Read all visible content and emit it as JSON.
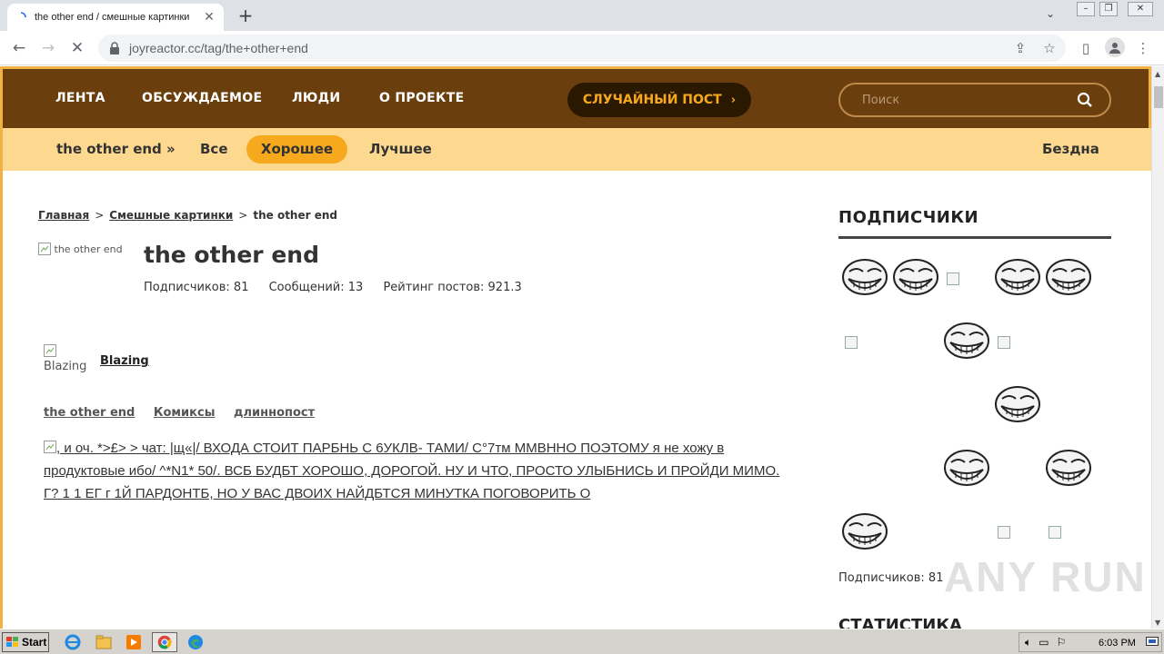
{
  "browser": {
    "tab_title": "the other end / смешные картинки",
    "url": "joyreactor.cc/tag/the+other+end"
  },
  "nav": {
    "links": [
      "ЛЕНТА",
      "ОБСУЖДАЕМОЕ",
      "ЛЮДИ",
      "О ПРОЕКТЕ"
    ],
    "random_post": "СЛУЧАЙНЫЙ ПОСТ",
    "search_placeholder": "Поиск"
  },
  "subnav": {
    "tag": "the other end »",
    "all": "Все",
    "good": "Хорошее",
    "best": "Лучшее",
    "abyss": "Бездна"
  },
  "breadcrumb": {
    "home": "Главная",
    "section": "Смешные картинки",
    "current": "the other end"
  },
  "tag": {
    "image_alt": "the other end",
    "title": "the other end",
    "subscribers": "Подписчиков: 81",
    "messages": "Сообщений: 13",
    "rating": "Рейтинг постов: 921.3"
  },
  "post": {
    "author_img_alt": "Blazing",
    "author": "Blazing",
    "tags": [
      "the other end",
      "Комиксы",
      "длиннопост"
    ],
    "image_alt": ", и оч. *>£> > чат: |щ«|/ ВХОДА СТОИТ ПАРБНЬ С 6УКЛВ- ТАМИ/ С°7тм ММВННО ПОЭТОМУ я не хожу в продуктовые ибо/ ^*N1* 50/. ВСБ БУДБТ ХОРОШО, ДОРОГОЙ. НУ И ЧТО, ПРОСТО УЛЫБНИСЬ И ПРОЙДИ МИМО. Г? 1 1 ЕГ г 1Й ПАРДОНТБ, НО У ВАС ДВОИХ НАЙДБТСЯ МИНУТКА ПОГОВОРИТЬ О"
  },
  "sidebar": {
    "subscribers_title": "ПОДПИСЧИКИ",
    "subscribers_count": "Подписчиков: 81",
    "stats_title": "СТАТИСТИКА"
  },
  "watermark": "ANY RUN",
  "taskbar": {
    "start": "Start",
    "clock": "6:03 PM"
  }
}
